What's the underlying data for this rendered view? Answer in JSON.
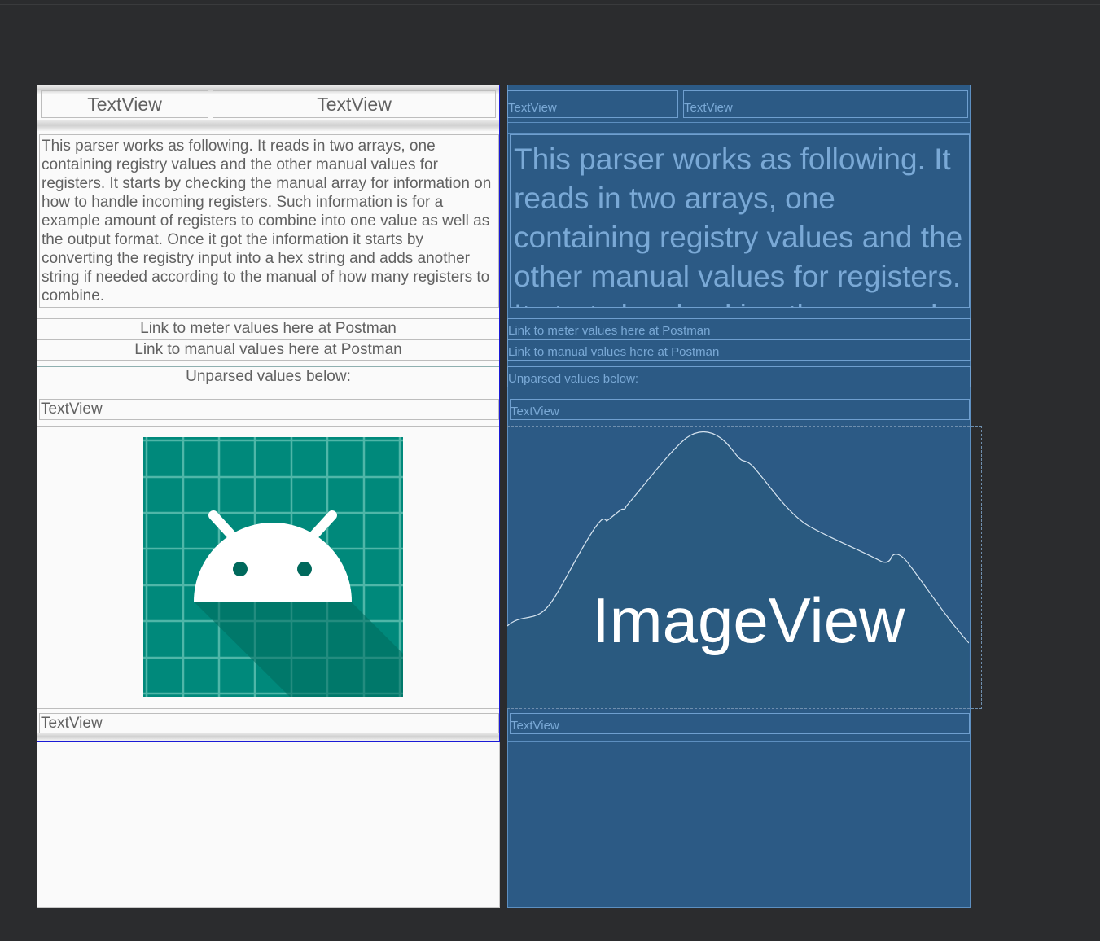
{
  "design": {
    "header_left": "TextView",
    "header_right": "TextView",
    "description": "This parser works as following. It reads in two arrays, one containing registry values and the other manual values for registers. It starts by checking the manual array for information on how to handle incoming registers. Such information is for a example amount of registers to combine into one value as well as the output format. Once it got the information it starts by converting the registry input into a hex string and adds another string if needed according to the manual of how many registers to combine.",
    "link_meter": "Link to meter values here at Postman",
    "link_manual": "Link to manual values here at Postman",
    "unparsed_label": "Unparsed values below:",
    "textview_1": "TextView",
    "image_icon": "android-launcher-icon",
    "textview_2": "TextView"
  },
  "blueprint": {
    "header_left": "TextView",
    "header_right": "TextView",
    "description": "This parser works as following. It reads in two arrays, one containing registry values and the other manual values for registers. It starts by checking the manual array for information on how to handle incoming registers.",
    "link_meter": "Link to meter values here at Postman",
    "link_manual": "Link to manual values here at Postman",
    "unparsed_label": "Unparsed values below:",
    "textview_1": "TextView",
    "imageview_label": "ImageView",
    "textview_2": "TextView"
  },
  "colors": {
    "canvas_bg": "#2b2c2e",
    "design_bg": "#fafafa",
    "blueprint_bg": "#2c5a85",
    "selection_border": "#1a1ad6",
    "icon_bg": "#00897b"
  }
}
